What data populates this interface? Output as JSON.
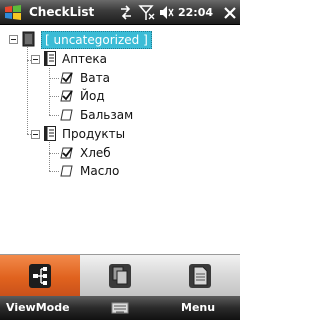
{
  "titlebar": {
    "app_title": "CheckList",
    "clock": "22:04"
  },
  "tree": {
    "root": {
      "label": "[ uncategorized ]",
      "selected": true
    },
    "groups": [
      {
        "label": "Аптека",
        "items": [
          {
            "label": "Вата",
            "checked": true
          },
          {
            "label": "Йод",
            "checked": true
          },
          {
            "label": "Бальзам",
            "checked": false
          }
        ]
      },
      {
        "label": "Продукты",
        "items": [
          {
            "label": "Хлеб",
            "checked": true
          },
          {
            "label": "Масло",
            "checked": false
          }
        ]
      }
    ]
  },
  "toolbar": {
    "buttons": [
      {
        "icon": "view-mode-tree-icon",
        "active": true
      },
      {
        "icon": "copy-pages-icon",
        "active": false
      },
      {
        "icon": "document-icon",
        "active": false
      }
    ]
  },
  "softkeys": {
    "left": "ViewMode",
    "right": "Menu"
  },
  "colors": {
    "selection": "#3bbcd6",
    "active_tool": "#e0621e",
    "checkmark": "#1a1a1a"
  }
}
